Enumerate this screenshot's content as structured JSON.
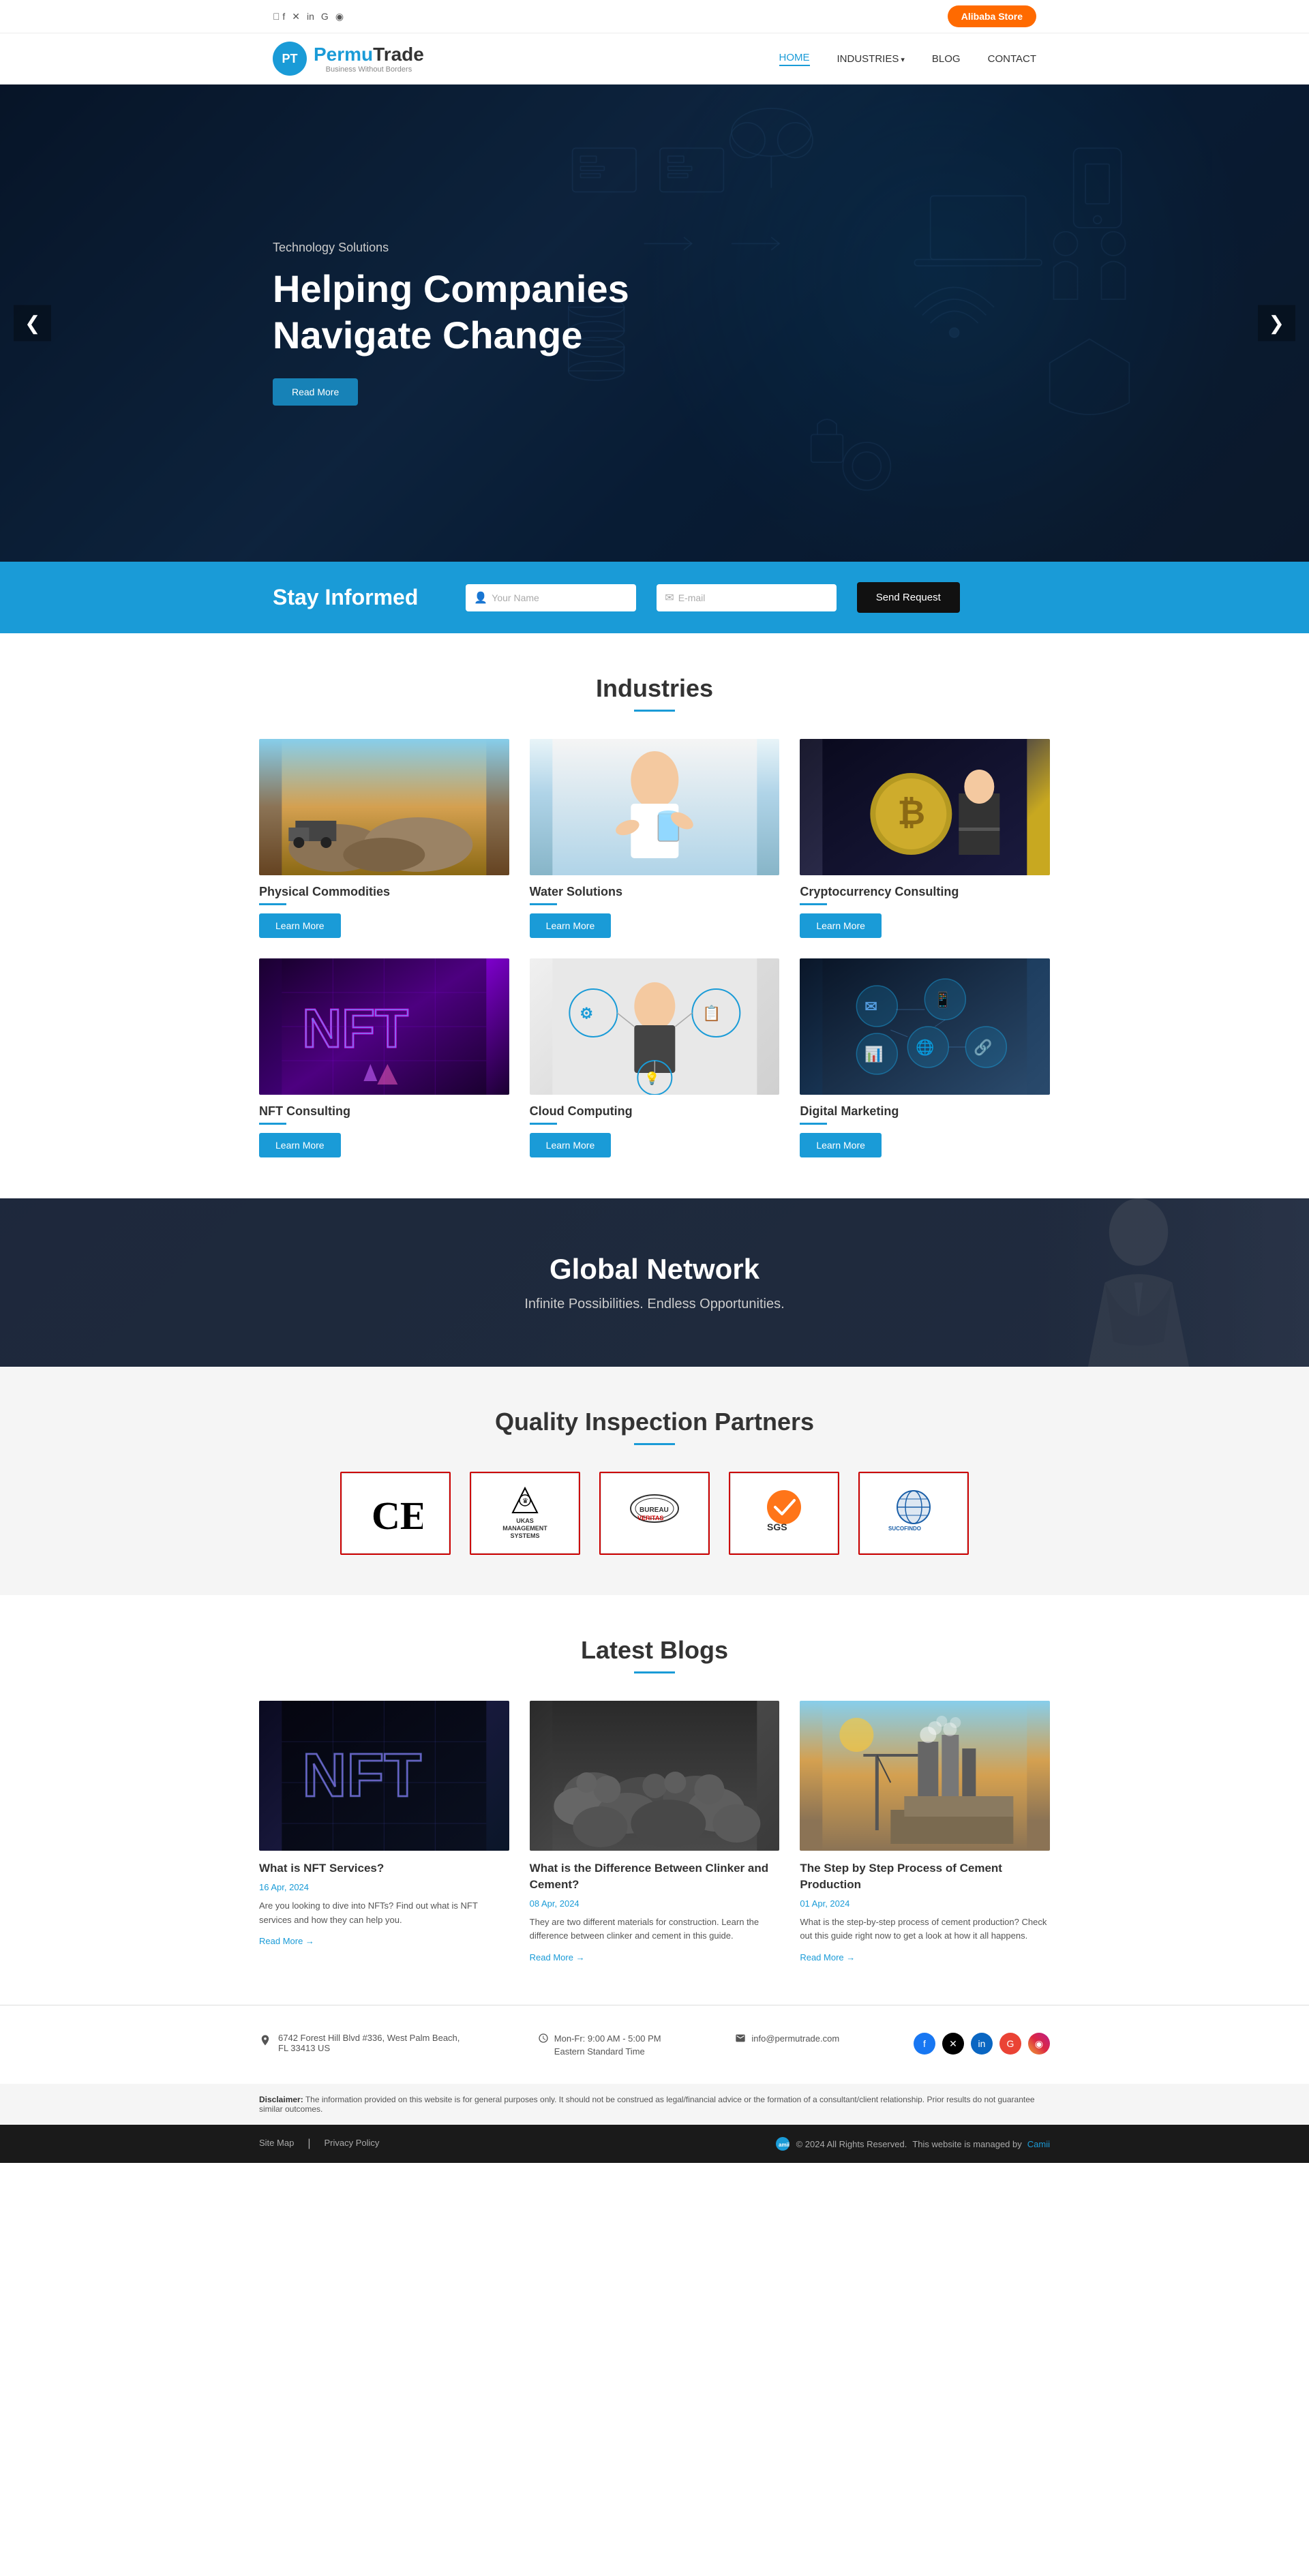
{
  "topbar": {
    "alibaba_label": "Alibaba Store",
    "social": [
      "facebook",
      "twitter",
      "linkedin",
      "google",
      "instagram"
    ]
  },
  "navbar": {
    "logo_initials": "PT",
    "logo_brand1": "Permu",
    "logo_brand2": "Trade",
    "logo_sub": "Business Without Borders",
    "links": [
      {
        "label": "HOME",
        "active": true
      },
      {
        "label": "INDUSTRIES",
        "has_arrow": true
      },
      {
        "label": "BLOG"
      },
      {
        "label": "CONTACT"
      }
    ]
  },
  "hero": {
    "subtitle": "Technology Solutions",
    "title": "Helping Companies\nNavigate Change",
    "btn_label": "Read More",
    "left_arrow": "❮",
    "right_arrow": "❯"
  },
  "stay_informed": {
    "heading": "Stay Informed",
    "name_placeholder": "Your Name",
    "email_placeholder": "E-mail",
    "btn_label": "Send Request"
  },
  "industries": {
    "section_title": "Industries",
    "items": [
      {
        "name": "Physical Commodities",
        "btn": "Learn More",
        "type": "commodities"
      },
      {
        "name": "Water Solutions",
        "btn": "Learn More",
        "type": "water"
      },
      {
        "name": "Cryptocurrency Consulting",
        "btn": "Learn More",
        "type": "crypto"
      },
      {
        "name": "NFT Consulting",
        "btn": "Learn More",
        "type": "nft"
      },
      {
        "name": "Cloud Computing",
        "btn": "Learn More",
        "type": "cloud"
      },
      {
        "name": "Digital Marketing",
        "btn": "Learn More",
        "type": "digital"
      }
    ]
  },
  "global_network": {
    "title": "Global Network",
    "subtitle": "Infinite Possibilities. Endless Opportunities."
  },
  "quality": {
    "title": "Quality Inspection Partners",
    "partners": [
      {
        "label": "CE",
        "type": "ce"
      },
      {
        "label": "UKAS",
        "type": "ukas"
      },
      {
        "label": "Bureau Veritas",
        "type": "bv"
      },
      {
        "label": "SGS",
        "type": "sgs"
      },
      {
        "label": "SUCOFINDO",
        "type": "sucofindo"
      }
    ]
  },
  "blogs": {
    "section_title": "Latest Blogs",
    "items": [
      {
        "title": "What is NFT Services?",
        "date": "16 Apr, 2024",
        "excerpt": "Are you looking to dive into NFTs? Find out what is NFT services and how they can help you.",
        "read_more": "Read More",
        "type": "blog1"
      },
      {
        "title": "What is the Difference Between Clinker and Cement?",
        "date": "08 Apr, 2024",
        "excerpt": "They are two different materials for construction. Learn the difference between clinker and cement in this guide.",
        "read_more": "Read More",
        "type": "blog2"
      },
      {
        "title": "The Step by Step Process of Cement Production",
        "date": "01 Apr, 2024",
        "excerpt": "What is the step-by-step process of cement production? Check out this guide right now to get a look at how it all happens.",
        "read_more": "Read More",
        "type": "blog3"
      }
    ]
  },
  "footer": {
    "address": "6742 Forest Hill Blvd #336, West Palm Beach, FL 33413 US",
    "hours_label": "Mon-Fr: 9:00 AM - 5:00 PM",
    "hours_sub": "Eastern Standard Time",
    "email": "info@permutrade.com",
    "disclaimer_label": "Disclaimer:",
    "disclaimer_text": "The information provided on this website is for general purposes only. It should not be construed as legal/financial advice or the formation of a consultant/client relationship. Prior results do not guarantee similar outcomes.",
    "site_map": "Site Map",
    "privacy": "Privacy Policy",
    "copyright": "© 2024 All Rights Reserved.",
    "managed_by": "This website is managed by",
    "amii": "Camii"
  }
}
